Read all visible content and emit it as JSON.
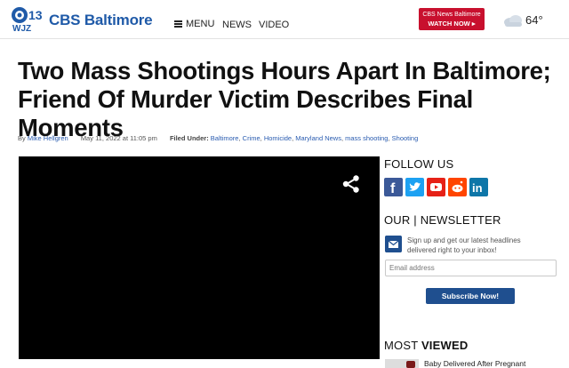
{
  "header": {
    "logo_text": "13 WJZ",
    "brand": "CBS Baltimore",
    "menu_label": "MENU",
    "nav": {
      "news": "NEWS",
      "video": "VIDEO"
    },
    "watch_now": {
      "line1": "CBS News Baltimore",
      "line2": "WATCH NOW ▸"
    },
    "weather": {
      "icon": "cloud-icon",
      "temperature": "64°"
    },
    "brand_color": "#1f5aa8",
    "accent_color": "#c8102e"
  },
  "article": {
    "headline": "Two Mass Shootings Hours Apart In Baltimore; Friend Of Murder Victim Describes Final Moments",
    "byline_prefix": "By",
    "author": "Mike Hellgren",
    "date": "May 11, 2022 at 11:05 pm",
    "filed_under_label": "Filed Under:",
    "tags": [
      "Baltimore",
      "Crime",
      "Homicide",
      "Maryland News",
      "mass shooting",
      "Shooting"
    ]
  },
  "sidebar": {
    "follow_title": "FOLLOW US",
    "social": [
      {
        "name": "facebook",
        "icon": "facebook-icon",
        "color": "#3b5998"
      },
      {
        "name": "twitter",
        "icon": "twitter-icon",
        "color": "#1da1f2"
      },
      {
        "name": "youtube",
        "icon": "youtube-icon",
        "color": "#e62117"
      },
      {
        "name": "reddit",
        "icon": "reddit-icon",
        "color": "#ff4500"
      },
      {
        "name": "linkedin",
        "icon": "linkedin-icon",
        "color": "#0e76a8"
      }
    ],
    "newsletter_title": "OUR | NEWSLETTER",
    "newsletter_desc": "Sign up and get our latest headlines delivered right to your inbox!",
    "email_placeholder": "Email address",
    "subscribe_label": "Subscribe Now!",
    "most_viewed_prefix": "MOST",
    "most_viewed_bold": "VIEWED",
    "most_viewed_first": "Baby Delivered After Pregnant"
  }
}
